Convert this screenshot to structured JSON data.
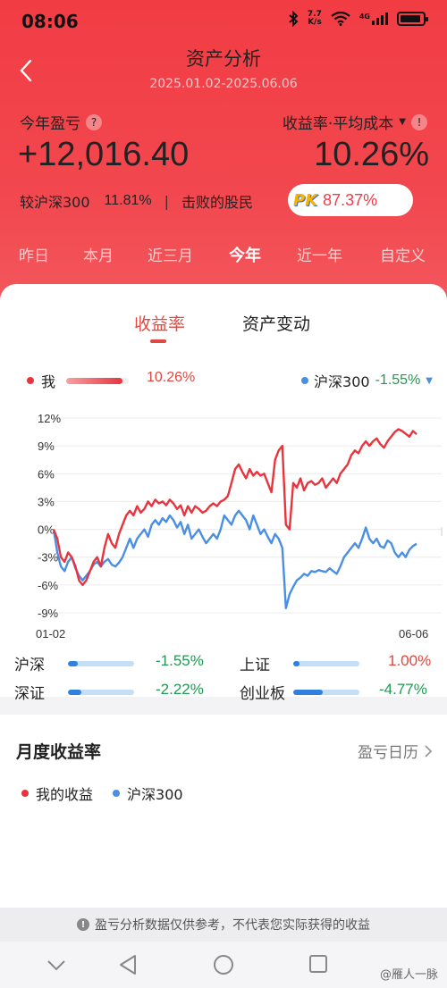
{
  "status": {
    "time": "08:06",
    "net_speed_top": "7.7",
    "net_speed_bottom": "K/s",
    "network_label": "4G"
  },
  "header": {
    "title": "资产分析",
    "date_range": "2025.01.02-2025.06.06"
  },
  "summary": {
    "profit_label": "今年盈亏",
    "profit_value": "+12,016.40",
    "rate_label": "收益率·平均成本",
    "rate_value": "10.26%",
    "compare_label": "较沪深300",
    "compare_value": "11.81%",
    "beat_label": "击败的股民",
    "pk_label": "PK",
    "beat_value": "87.37%"
  },
  "period_tabs": [
    {
      "label": "昨日",
      "active": false
    },
    {
      "label": "本月",
      "active": false
    },
    {
      "label": "近三月",
      "active": false
    },
    {
      "label": "今年",
      "active": true
    },
    {
      "label": "近一年",
      "active": false
    },
    {
      "label": "自定义",
      "active": false
    }
  ],
  "chart_tabs": [
    {
      "label": "收益率",
      "active": true
    },
    {
      "label": "资产变动",
      "active": false
    }
  ],
  "legend": {
    "me_label": "我",
    "me_value": "10.26%",
    "me_color": "#e8343c",
    "hs_label": "沪深300",
    "hs_value": "-1.55%",
    "hs_color": "#4a8fe2"
  },
  "chart_data": {
    "type": "line",
    "ylim": [
      -9,
      12
    ],
    "yticks": [
      "12%",
      "9%",
      "6%",
      "3%",
      "0%",
      "-3%",
      "-6%",
      "-9%"
    ],
    "ytick_values": [
      12,
      9,
      6,
      3,
      0,
      -3,
      -6,
      -9
    ],
    "x_start_label": "01-02",
    "x_end_label": "06-06",
    "series": [
      {
        "name": "我",
        "color": "#e8343c",
        "values": [
          0.0,
          -1.0,
          -3.0,
          -3.5,
          -2.5,
          -3.0,
          -4.0,
          -5.5,
          -6.0,
          -5.5,
          -4.5,
          -3.5,
          -3.0,
          -4.0,
          -2.0,
          -0.5,
          -1.5,
          -2.0,
          -0.5,
          0.5,
          1.5,
          2.0,
          1.5,
          2.5,
          1.8,
          2.2,
          3.0,
          2.5,
          3.2,
          2.8,
          3.0,
          2.6,
          3.2,
          2.8,
          2.2,
          2.6,
          1.5,
          2.5,
          1.8,
          2.5,
          2.2,
          1.8,
          2.0,
          2.5,
          2.8,
          2.5,
          3.0,
          3.2,
          3.6,
          5.0,
          6.5,
          7.0,
          6.2,
          5.5,
          6.5,
          5.8,
          6.2,
          5.8,
          6.0,
          5.0,
          4.0,
          7.5,
          8.5,
          9.0,
          0.5,
          0.0,
          5.0,
          4.5,
          5.5,
          4.2,
          5.0,
          5.2,
          4.8,
          5.0,
          5.5,
          4.5,
          5.0,
          5.5,
          5.0,
          6.0,
          6.5,
          7.0,
          8.0,
          8.5,
          8.2,
          9.0,
          9.5,
          9.0,
          9.5,
          9.8,
          9.2,
          8.8,
          9.5,
          10.0,
          10.5,
          10.8,
          10.6,
          10.3,
          10.0,
          10.6,
          10.26
        ]
      },
      {
        "name": "沪深300",
        "color": "#4a8fe2",
        "values": [
          0.0,
          -2.5,
          -4.0,
          -4.5,
          -3.5,
          -3.0,
          -4.2,
          -5.0,
          -5.5,
          -5.0,
          -4.5,
          -3.8,
          -3.5,
          -4.0,
          -3.5,
          -3.2,
          -3.8,
          -4.0,
          -3.6,
          -3.0,
          -2.0,
          -1.0,
          -2.0,
          -1.0,
          -0.5,
          0.0,
          -0.8,
          0.5,
          1.0,
          0.5,
          1.2,
          0.8,
          1.5,
          1.0,
          0.2,
          0.8,
          -0.5,
          0.5,
          -1.0,
          -0.5,
          0.0,
          -0.8,
          -1.5,
          -1.0,
          -0.5,
          -1.0,
          0.0,
          1.5,
          1.0,
          0.5,
          1.5,
          2.0,
          1.5,
          1.0,
          0.0,
          1.5,
          0.5,
          -0.5,
          0.0,
          -0.8,
          -1.5,
          -0.5,
          -1.0,
          -2.0,
          -8.5,
          -7.0,
          -6.2,
          -5.5,
          -5.2,
          -4.8,
          -5.0,
          -4.5,
          -4.6,
          -4.4,
          -4.5,
          -4.6,
          -4.2,
          -4.5,
          -4.8,
          -4.0,
          -3.0,
          -2.5,
          -2.0,
          -1.5,
          -2.0,
          -1.0,
          0.2,
          -1.0,
          -1.5,
          -1.0,
          -1.8,
          -2.0,
          -1.2,
          -1.5,
          -2.5,
          -3.0,
          -2.5,
          -3.0,
          -2.2,
          -1.8,
          -1.55
        ]
      }
    ]
  },
  "indices": [
    {
      "name": "沪深",
      "value": "-1.55%",
      "fill_fraction": 0.15,
      "value_color": "#1f9a52"
    },
    {
      "name": "上证",
      "value": "1.00%",
      "fill_fraction": 0.1,
      "value_color": "#e2473f"
    },
    {
      "name": "深证",
      "value": "-2.22%",
      "fill_fraction": 0.2,
      "value_color": "#1f9a52"
    },
    {
      "name": "创业板",
      "value": "-4.77%",
      "fill_fraction": 0.45,
      "value_color": "#1f9a52"
    }
  ],
  "monthly": {
    "title": "月度收益率",
    "calendar_link": "盈亏日历",
    "legend_me": "我的收益",
    "legend_hs": "沪深300"
  },
  "disclaimer": "盈亏分析数据仅供参考，不代表您实际获得的收益",
  "watermark": "@雁人一脉"
}
